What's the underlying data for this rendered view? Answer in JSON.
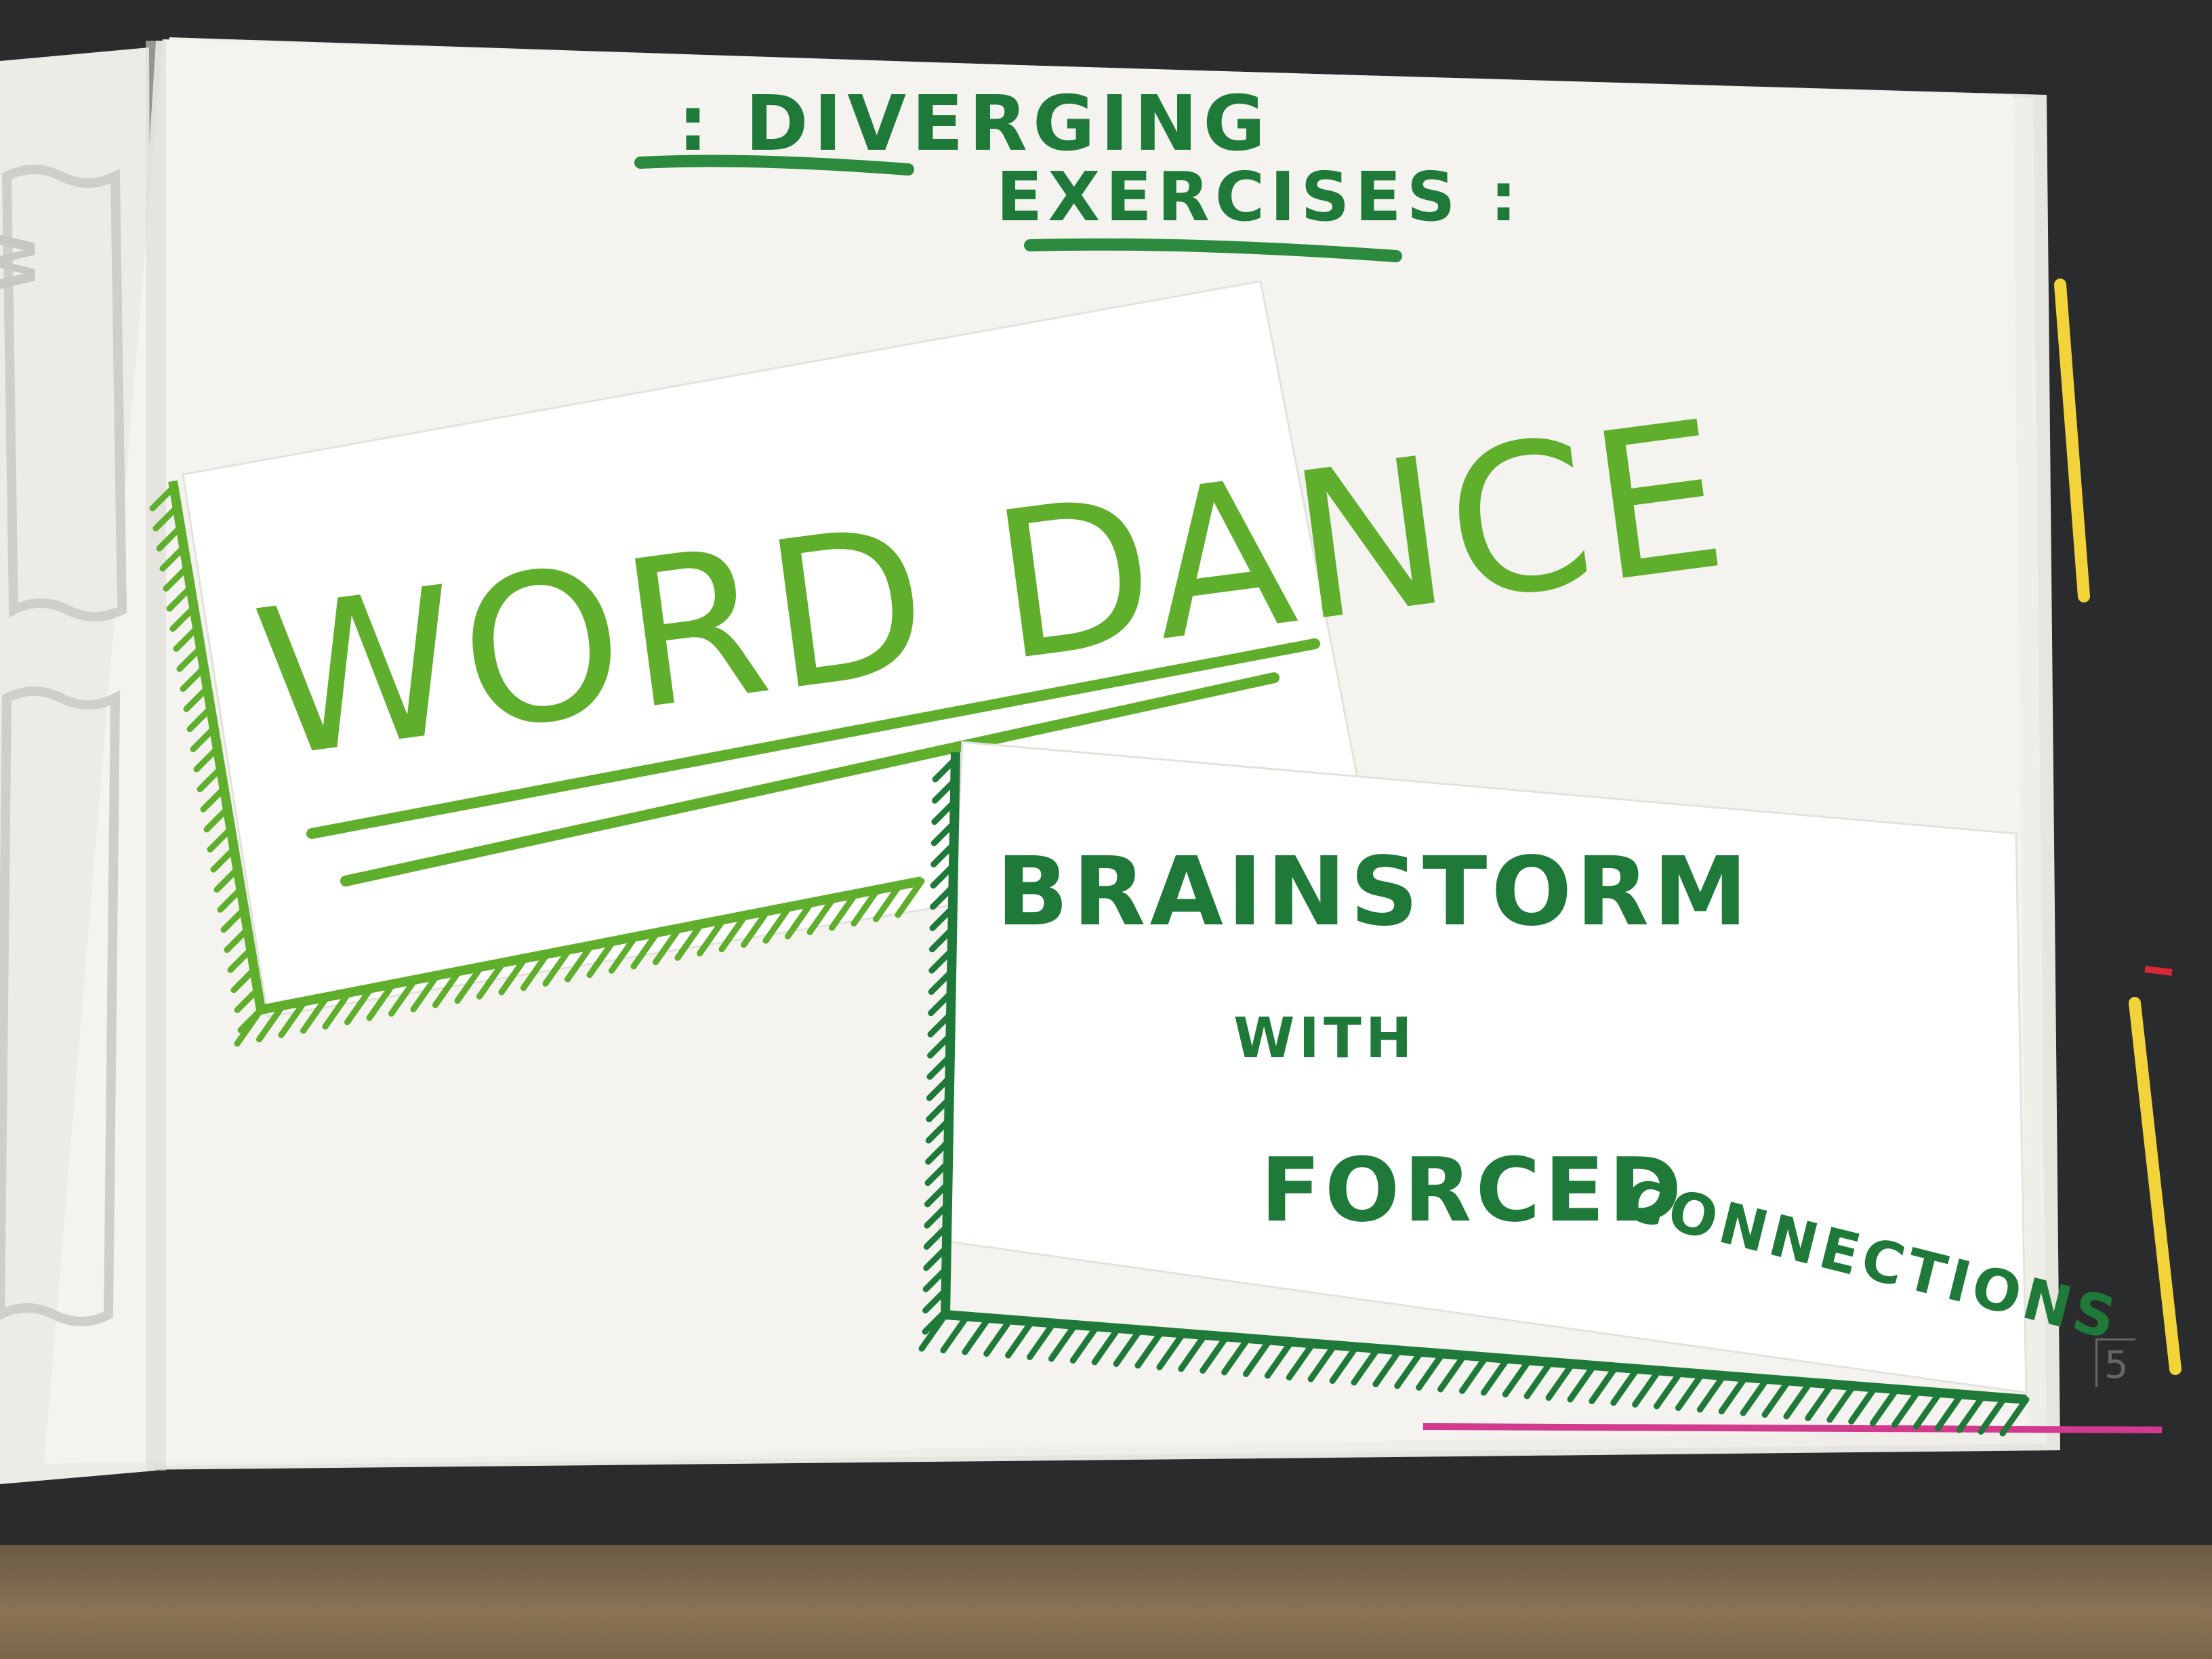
{
  "header": {
    "title_line1": ": DIVERGING",
    "title_line2": "EXERCISES :"
  },
  "card_word_dance": {
    "label": "WORD DANCE"
  },
  "card_brainstorm": {
    "line1": "BRAINSTORM",
    "line2": "WITH",
    "line3": "FORCED",
    "line4": "CONNECTIONS"
  },
  "page_number": "5",
  "colors": {
    "ink_dark_green": "#1f7a3a",
    "ink_light_green": "#5fae2c",
    "paper": "#f4f3ef",
    "highlighter_yellow": "#f2d43a",
    "marker_red": "#d8263a",
    "marker_pink": "#d23a8e"
  }
}
